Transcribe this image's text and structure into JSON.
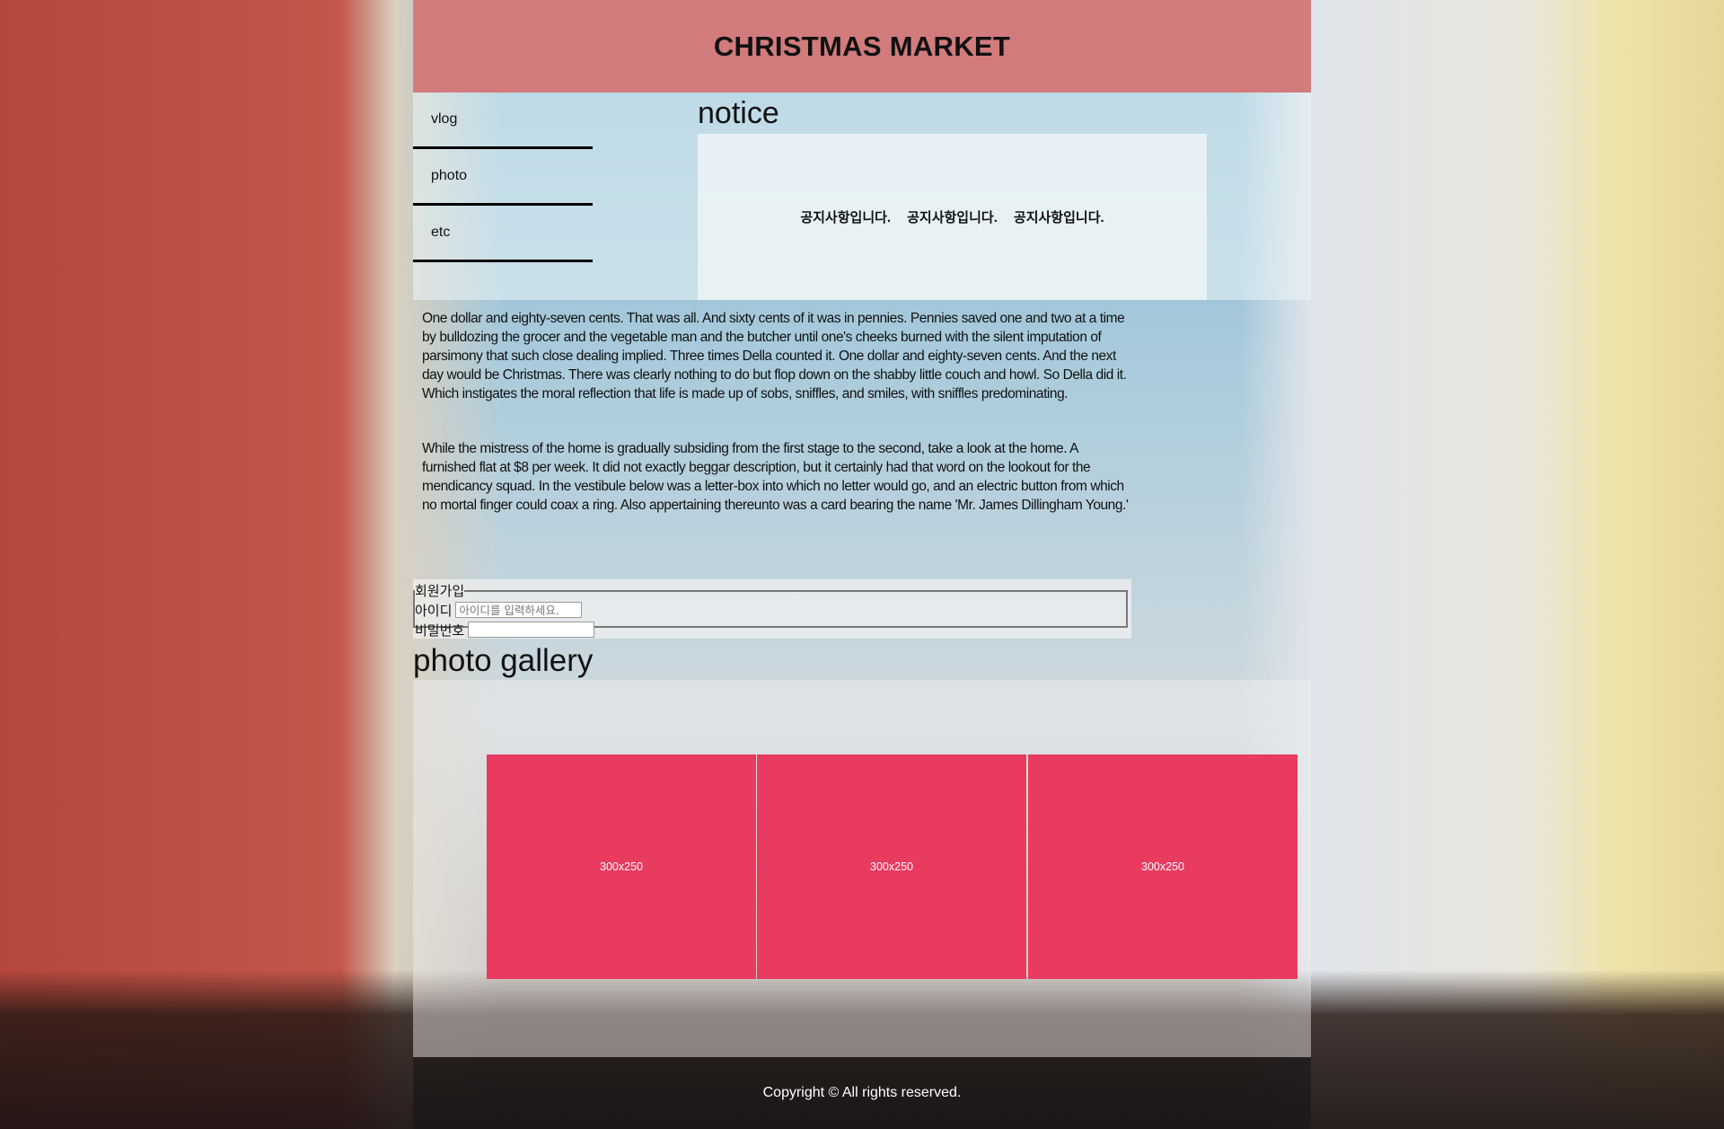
{
  "header": {
    "title": "CHRISTMAS MARKET"
  },
  "nav": {
    "items": [
      {
        "label": "vlog"
      },
      {
        "label": "photo"
      },
      {
        "label": "etc"
      }
    ]
  },
  "notice": {
    "title": "notice",
    "items": [
      "공지사항입니다.",
      "공지사항입니다.",
      "공지사항입니다."
    ]
  },
  "content": {
    "paragraphs": [
      "One dollar and eighty-seven cents. That was all. And sixty cents of it was in pennies. Pennies saved one and two at a time by bulldozing the grocer and the vegetable man and the butcher until one's cheeks burned with the silent imputation of parsimony that such close dealing implied. Three times Della counted it. One dollar and eighty-seven cents. And the next day would be Christmas. There was clearly nothing to do but flop down on the shabby little couch and howl. So Della did it. Which instigates the moral reflection that life is made up of sobs, sniffles, and smiles, with sniffles predominating.",
      "While the mistress of the home is gradually subsiding from the first stage to the second, take a look at the home. A furnished flat at $8 per week. It did not exactly beggar description, but it certainly had that word on the lookout for the mendicancy squad. In the vestibule below was a letter-box into which no letter would go, and an electric button from which no mortal finger could coax a ring. Also appertaining thereunto was a card bearing the name 'Mr. James Dillingham Young.'"
    ]
  },
  "signup": {
    "legend": "회원가입",
    "id_label": "아이디",
    "id_value": "",
    "id_placeholder": "아이디를 입력하세요.",
    "password_label": "비밀번호",
    "password_value": ""
  },
  "gallery": {
    "title": "photo gallery",
    "images": [
      {
        "label": "300x250"
      },
      {
        "label": "300x250"
      },
      {
        "label": "300x250"
      }
    ],
    "image_color": "#e83b5f"
  },
  "footer": {
    "text": "Copyright © All rights reserved."
  },
  "colors": {
    "header_bg": "#d27b7c"
  }
}
